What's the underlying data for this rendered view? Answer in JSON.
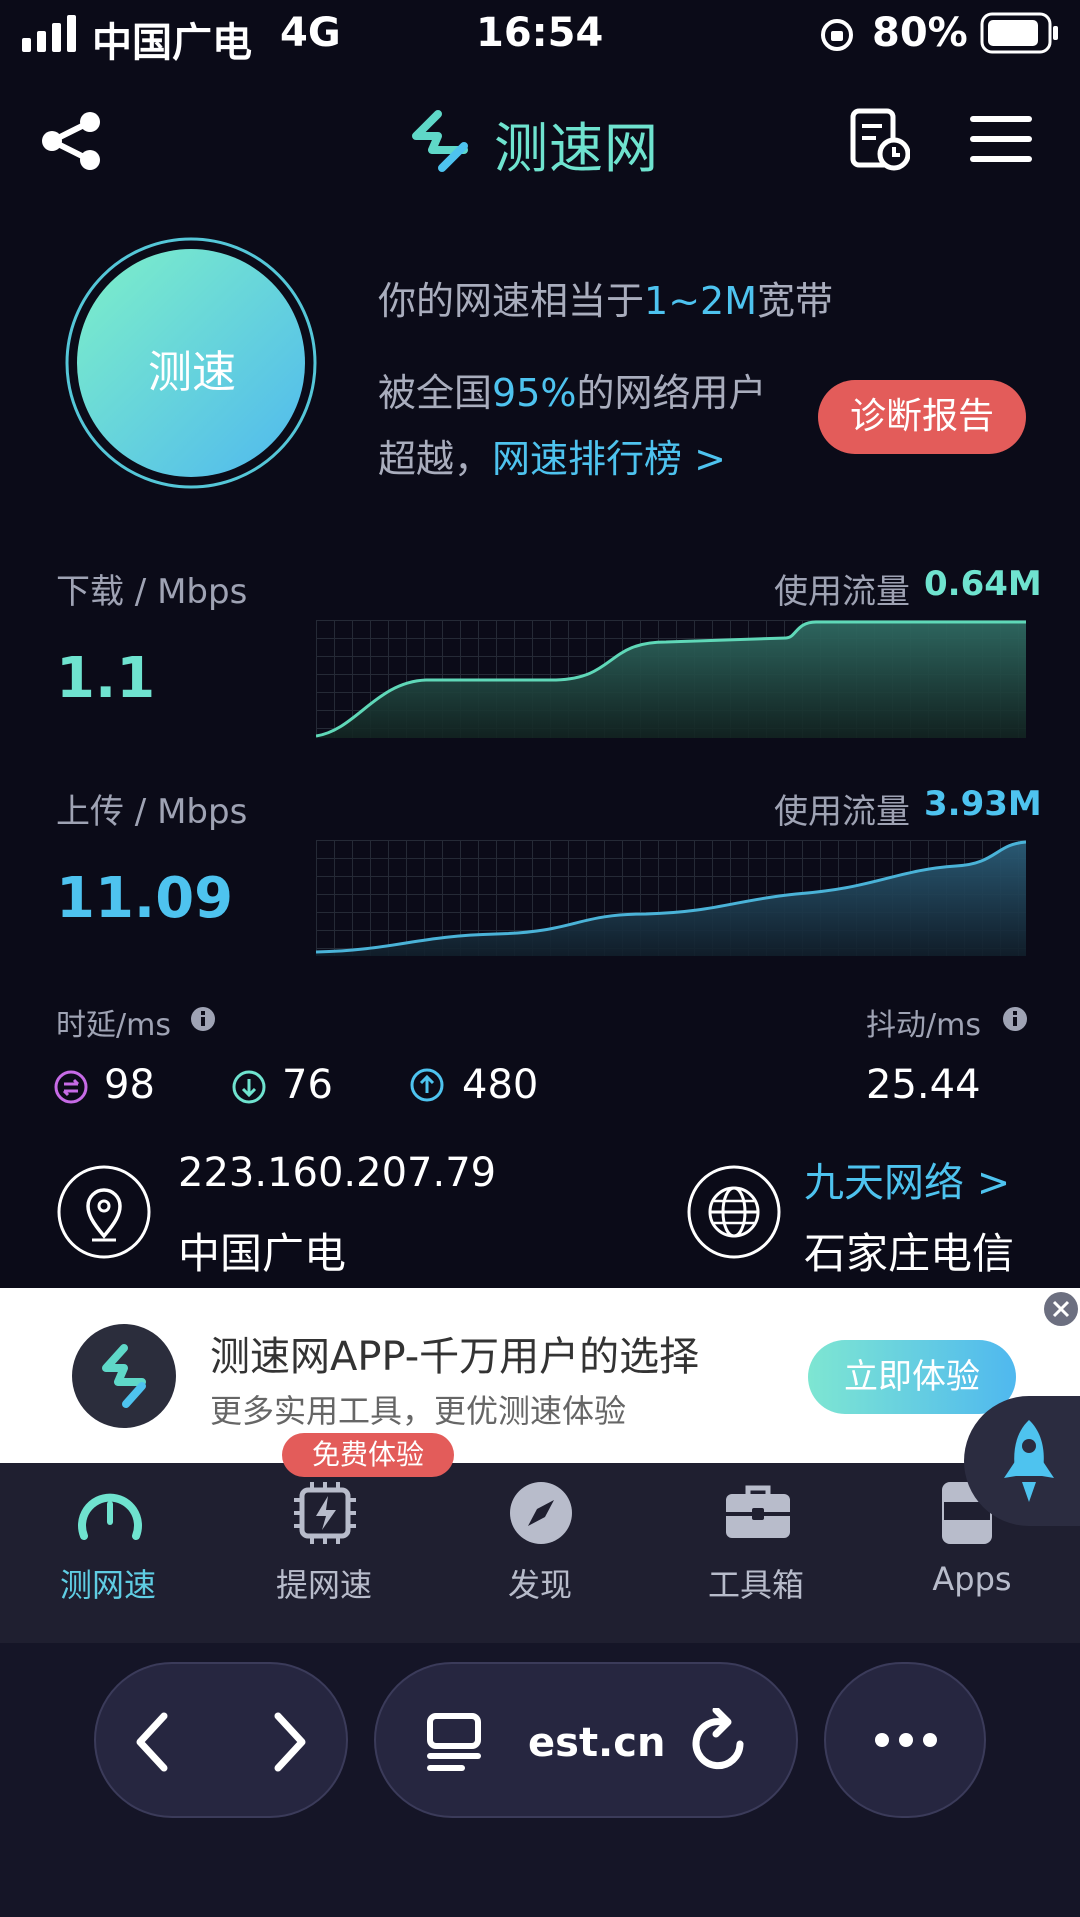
{
  "status_bar": {
    "carrier": "中国广电",
    "network": "4G",
    "time": "16:54",
    "battery": "80%"
  },
  "header": {
    "title": "测速网"
  },
  "result": {
    "test_button_label": "测速",
    "line1_prefix": "你的网速相当于",
    "line1_highlight": "1~2M",
    "line1_suffix": "宽带",
    "line2_prefix": "被全国",
    "line2_highlight": "95%",
    "line2_suffix": "的网络用户",
    "line3_prefix": "超越，",
    "line3_link": "网速排行榜 >",
    "report_button": "诊断报告"
  },
  "download": {
    "label": "下载 / Mbps",
    "value": "1.1",
    "traffic_label": "使用流量",
    "traffic_value": "0.64M"
  },
  "upload": {
    "label": "上传 / Mbps",
    "value": "11.09",
    "traffic_label": "使用流量",
    "traffic_value": "3.93M"
  },
  "latency": {
    "label": "时延/ms",
    "idle": "98",
    "down": "76",
    "up": "480",
    "jitter_label": "抖动/ms",
    "jitter": "25.44"
  },
  "network_info": {
    "ip": "223.160.207.79",
    "isp": "中国广电",
    "server_link": "九天网络 >",
    "server_name": "石家庄电信"
  },
  "ad": {
    "title": "测速网APP-千万用户的选择",
    "subtitle": "更多实用工具，更优测速体验",
    "button": "立即体验"
  },
  "tabs": [
    {
      "label": "测网速",
      "active": true
    },
    {
      "label": "提网速",
      "badge": "免费体验"
    },
    {
      "label": "发现"
    },
    {
      "label": "工具箱"
    },
    {
      "label": "Apps"
    }
  ],
  "browser": {
    "url": "est.cn"
  },
  "colors": {
    "accent_green": "#6fe3cf",
    "accent_blue": "#4ec3ef",
    "report_red": "#e35c5a",
    "background": "#0b0b18"
  }
}
